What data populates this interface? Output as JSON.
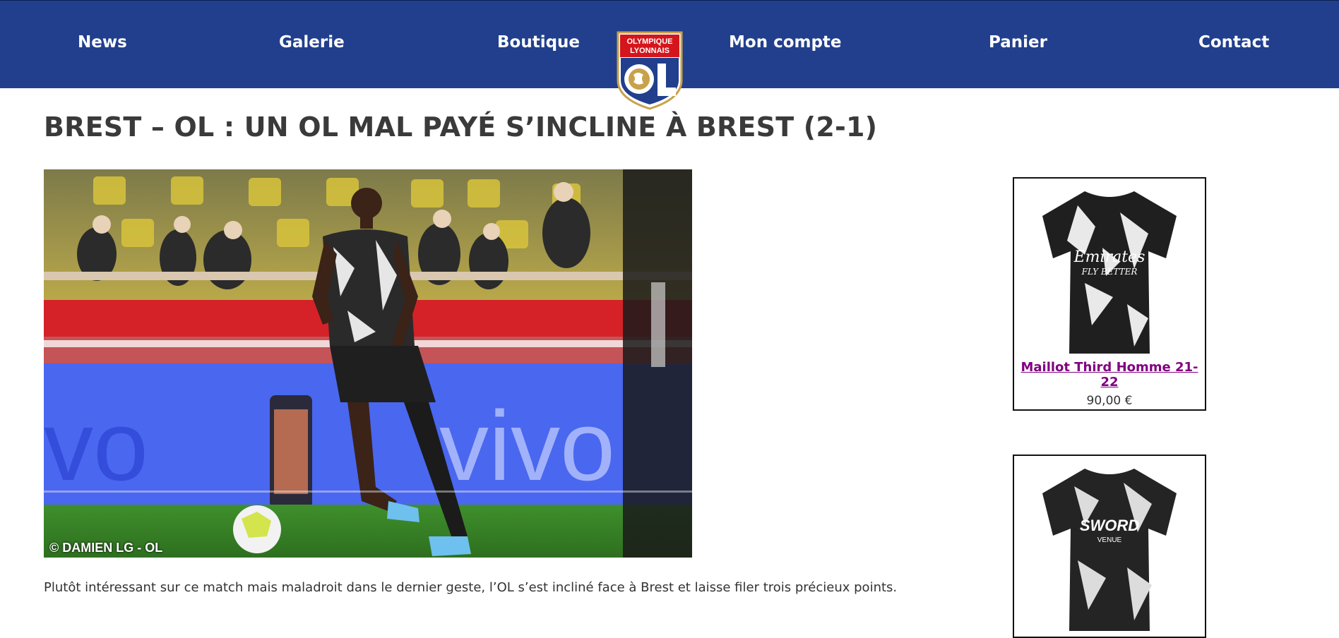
{
  "nav": {
    "items": [
      "News",
      "Galerie",
      "Boutique",
      "Mon compte",
      "Panier",
      "Contact"
    ],
    "logo_text": [
      "OLYMPIQUE",
      "LYONNAIS"
    ]
  },
  "colors": {
    "nav_bg": "#213f8c",
    "link": "#800080",
    "logo_red": "#d4161c",
    "logo_gold": "#c9a14a"
  },
  "article": {
    "title": "BREST – OL : UN OL MAL PAYÉ S’INCLINE À BREST (2-1)",
    "photo_credit": "© DAMIEN LG - OL",
    "intro": "Plutôt intéressant sur ce match mais maladroit dans le dernier geste, l’OL s’est incliné face à Brest et laisse filer trois précieux points."
  },
  "sidebar": {
    "products": [
      {
        "name": "Maillot Third Homme 21-22",
        "price": "90,00 €",
        "print_top": "Emirates",
        "print_sub": "FLY BETTER"
      },
      {
        "name": "",
        "price": "",
        "print_top": "SWORD",
        "print_sub": "VENUE"
      }
    ]
  }
}
